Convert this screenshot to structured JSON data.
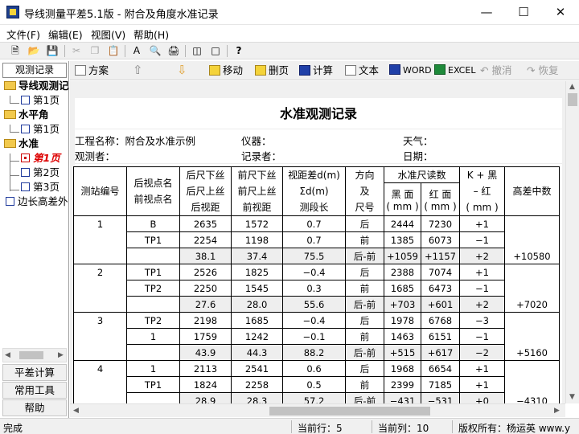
{
  "window": {
    "title": "导线测量平差5.1版 - 附合及角度水准记录"
  },
  "menu": [
    "文件(F)",
    "编辑(E)",
    "视图(V)",
    "帮助(H)"
  ],
  "left_panel": {
    "tab": "观测记录",
    "tree": [
      {
        "label": "导线观测记",
        "type": "folder"
      },
      {
        "label": "第1页",
        "type": "page"
      },
      {
        "label": "水平角",
        "type": "folder"
      },
      {
        "label": "第1页",
        "type": "page"
      },
      {
        "label": "水准",
        "type": "folder"
      },
      {
        "label": "第1页",
        "type": "page",
        "selected": true
      },
      {
        "label": "第2页",
        "type": "page"
      },
      {
        "label": "第3页",
        "type": "page"
      },
      {
        "label": "边长高差外",
        "type": "page"
      }
    ],
    "buttons": [
      "平差计算",
      "常用工具",
      "帮助"
    ]
  },
  "right_toolbar": {
    "scheme": "方案",
    "move": "移动",
    "delete_page": "删页",
    "calc": "计算",
    "text": "文本",
    "word": "WORD",
    "excel": "EXCEL",
    "undo": "撤消",
    "redo": "恢复"
  },
  "document": {
    "title": "水准观测记录",
    "project_label": "工程名称：附合及水准示例",
    "instrument_label": "仪器：",
    "weather_label": "天气：",
    "observer_label": "观测者：",
    "recorder_label": "记录者：",
    "date_label": "日期：",
    "headers": {
      "station": "测站编号",
      "back_fore_name": [
        "后视点名",
        "前视点名"
      ],
      "back_ruler": [
        "后尺下丝",
        "后尺上丝",
        "后视距"
      ],
      "fore_ruler": [
        "前尺下丝",
        "前尺上丝",
        "前视距"
      ],
      "dist_diff": [
        "视距差d(m)",
        "Σd(m)",
        "测段长"
      ],
      "direction": [
        "方向",
        "及",
        "尺号"
      ],
      "reading_group": "水准尺读数",
      "black": [
        "黑 面",
        "( mm )"
      ],
      "red": [
        "红 面",
        "( mm )"
      ],
      "k_black_red": [
        "K + 黑",
        "– 红",
        "( mm )"
      ],
      "height_mean": "高差中数"
    },
    "rows": [
      {
        "station": "1",
        "name": "B",
        "a": "2635",
        "b": "1572",
        "d": "0.7",
        "dir": "后",
        "black": "2444",
        "red": "7230",
        "k": "+1",
        "mean": ""
      },
      {
        "station": "",
        "name": "TP1",
        "a": "2254",
        "b": "1198",
        "d": "0.7",
        "dir": "前",
        "black": "1385",
        "red": "6073",
        "k": "−1",
        "mean": ""
      },
      {
        "station": "",
        "name": "",
        "a": "38.1",
        "b": "37.4",
        "d": "75.5",
        "dir": "后-前",
        "black": "+1059",
        "red": "+1157",
        "k": "+2",
        "mean": "+10580"
      },
      {
        "station": "2",
        "name": "TP1",
        "a": "2526",
        "b": "1825",
        "d": "−0.4",
        "dir": "后",
        "black": "2388",
        "red": "7074",
        "k": "+1",
        "mean": ""
      },
      {
        "station": "",
        "name": "TP2",
        "a": "2250",
        "b": "1545",
        "d": "0.3",
        "dir": "前",
        "black": "1685",
        "red": "6473",
        "k": "−1",
        "mean": ""
      },
      {
        "station": "",
        "name": "",
        "a": "27.6",
        "b": "28.0",
        "d": "55.6",
        "dir": "后-前",
        "black": "+703",
        "red": "+601",
        "k": "+2",
        "mean": "+7020"
      },
      {
        "station": "3",
        "name": "TP2",
        "a": "2198",
        "b": "1685",
        "d": "−0.4",
        "dir": "后",
        "black": "1978",
        "red": "6768",
        "k": "−3",
        "mean": ""
      },
      {
        "station": "",
        "name": "1",
        "a": "1759",
        "b": "1242",
        "d": "−0.1",
        "dir": "前",
        "black": "1463",
        "red": "6151",
        "k": "−1",
        "mean": ""
      },
      {
        "station": "",
        "name": "",
        "a": "43.9",
        "b": "44.3",
        "d": "88.2",
        "dir": "后-前",
        "black": "+515",
        "red": "+617",
        "k": "−2",
        "mean": "+5160"
      },
      {
        "station": "4",
        "name": "1",
        "a": "2113",
        "b": "2541",
        "d": "0.6",
        "dir": "后",
        "black": "1968",
        "red": "6654",
        "k": "+1",
        "mean": ""
      },
      {
        "station": "",
        "name": "TP1",
        "a": "1824",
        "b": "2258",
        "d": "0.5",
        "dir": "前",
        "black": "2399",
        "red": "7185",
        "k": "+1",
        "mean": ""
      },
      {
        "station": "",
        "name": "",
        "a": "28.9",
        "b": "28.3",
        "d": "57.2",
        "dir": "后-前",
        "black": "−431",
        "red": "−531",
        "k": "+0",
        "mean": "−4310"
      }
    ]
  },
  "status": {
    "left": "完成",
    "row": "当前行：5",
    "col": "当前列：10",
    "copyright": "版权所有：杨运英 www.y"
  }
}
